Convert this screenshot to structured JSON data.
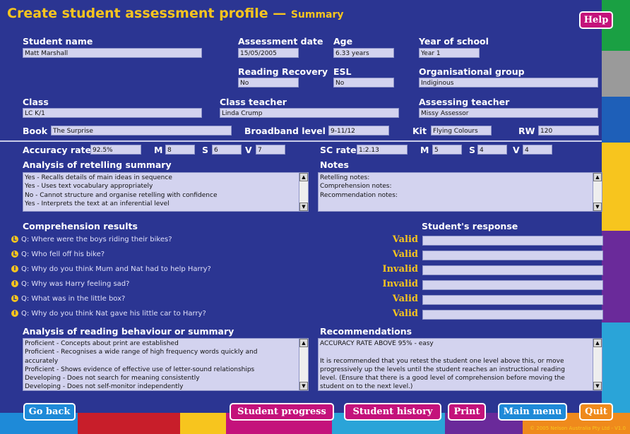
{
  "title": {
    "main": "Create student assessment profile",
    "dash": " — ",
    "sub": "Summary"
  },
  "help_label": "Help",
  "labels": {
    "student_name": "Student name",
    "assessment_date": "Assessment date",
    "age": "Age",
    "year_of_school": "Year of school",
    "reading_recovery": "Reading Recovery",
    "esl": "ESL",
    "organisational_group": "Organisational group",
    "class": "Class",
    "class_teacher": "Class teacher",
    "assessing_teacher": "Assessing teacher",
    "book": "Book",
    "broadband_level": "Broadband level",
    "kit": "Kit",
    "rw": "RW",
    "accuracy_rate": "Accuracy rate",
    "m": "M",
    "s": "S",
    "v": "V",
    "sc_rate": "SC rate",
    "analysis_retelling": "Analysis of retelling summary",
    "notes": "Notes",
    "comprehension_results": "Comprehension results",
    "students_response": "Student's response",
    "analysis_reading": "Analysis of reading behaviour or summary",
    "recommendations": "Recommendations"
  },
  "fields": {
    "student_name": "Matt Marshall",
    "assessment_date": "15/05/2005",
    "age": "6.33 years",
    "year_of_school": "Year 1",
    "reading_recovery": "No",
    "esl": "No",
    "organisational_group": "Indiginous",
    "class": "LC K/1",
    "class_teacher": "Linda Crump",
    "assessing_teacher": "Missy Assessor",
    "book": "The Surprise",
    "broadband_level": "9-11/12",
    "kit": "Flying Colours",
    "rw": "120",
    "accuracy_rate": "92.5%",
    "acc_m": "8",
    "acc_s": "6",
    "acc_v": "7",
    "sc_rate": "1:2.13",
    "sc_m": "5",
    "sc_s": "4",
    "sc_v": "4"
  },
  "retelling_lines": [
    "Yes - Recalls details of main ideas in sequence",
    "Yes - Uses text vocabulary appropriately",
    "No - Cannot structure and organise retelling with confidence",
    "Yes - Interprets the text at an inferential level"
  ],
  "notes_lines": [
    "Retelling notes:",
    "Comprehension notes:",
    "Recommendation notes:"
  ],
  "comprehension": [
    {
      "icon": "L",
      "question": "Q: Where were the boys riding their bikes?",
      "result": "Valid"
    },
    {
      "icon": "L",
      "question": "Q: Who fell off his bike?",
      "result": "Valid"
    },
    {
      "icon": "I",
      "question": "Q: Why do you think Mum and Nat had to help Harry?",
      "result": "Invalid"
    },
    {
      "icon": "I",
      "question": "Q: Why was Harry feeling sad?",
      "result": "Invalid"
    },
    {
      "icon": "L",
      "question": "Q: What was in the little box?",
      "result": "Valid"
    },
    {
      "icon": "I",
      "question": "Q: Why do you think Nat gave his little car to Harry?",
      "result": "Valid"
    }
  ],
  "reading_lines": [
    "Proficient - Concepts about print are established",
    "Proficient - Recognises a wide range of high frequency words quickly and",
    "accurately",
    "Proficient - Shows evidence of effective use of letter-sound relationships",
    "Developing - Does not search for meaning consistently",
    "Developing - Does not self-monitor independently"
  ],
  "recommendation_lines": [
    "ACCURACY RATE ABOVE 95% - easy",
    "",
    "It is recommended that you retest the student one level above this, or move",
    "progressively up the levels until the student reaches an instructional reading",
    "level.  (Ensure that there is a good level of comprehension before moving the",
    "student on to the next level.)"
  ],
  "buttons": {
    "go_back": "Go back",
    "student_progress": "Student progress",
    "student_history": "Student history",
    "print": "Print",
    "main_menu": "Main menu",
    "quit": "Quit"
  },
  "copyright": "© 2005 Nelson Australia Pty Ltd - V1.0",
  "colors": {
    "background": "#2b3592",
    "title": "#f7c51e",
    "valid": "#f7c51e",
    "help_button": "#c4127b",
    "field": "#d3d3ef"
  }
}
